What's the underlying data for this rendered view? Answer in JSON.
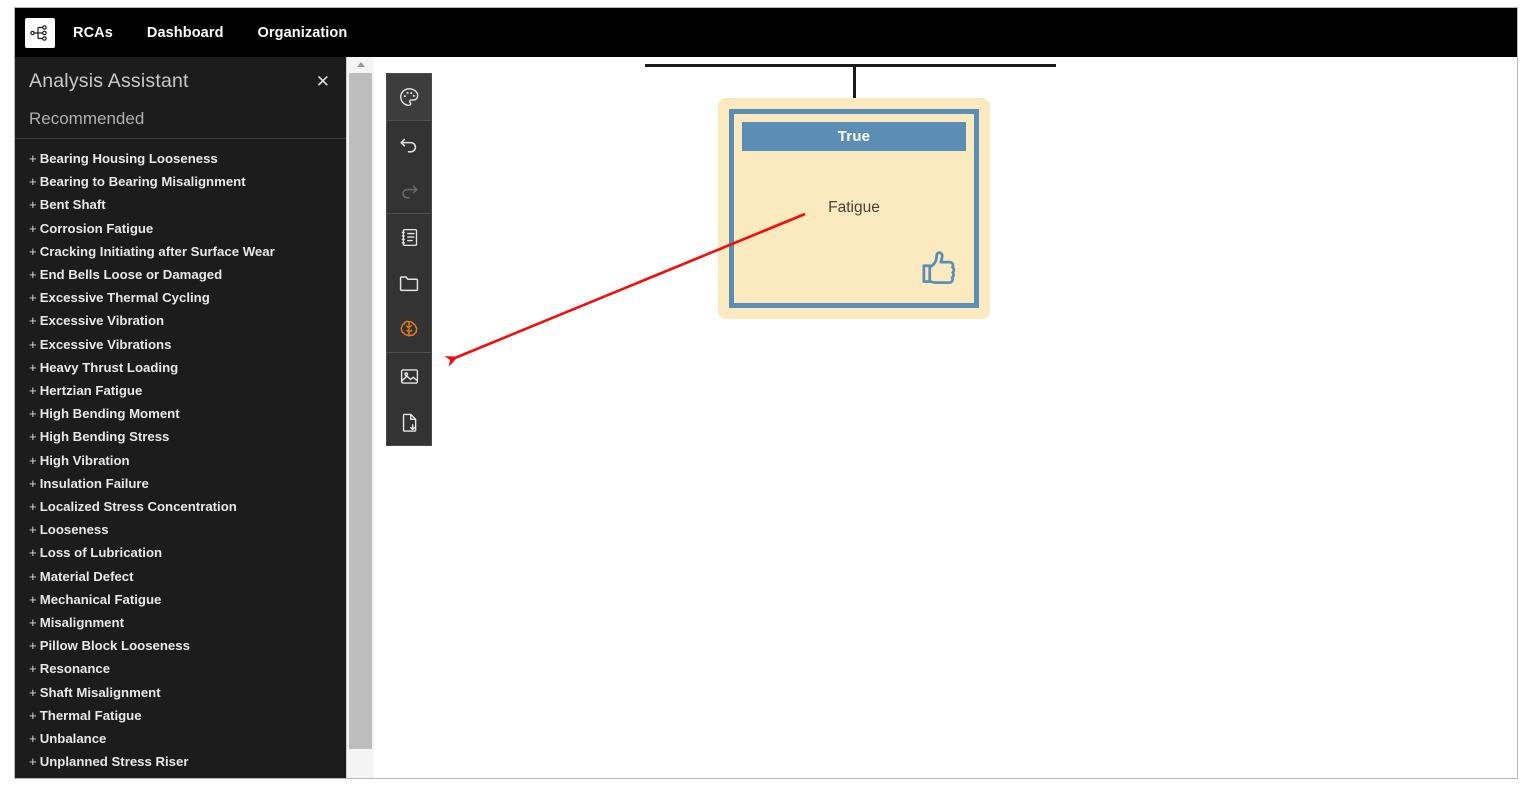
{
  "topnav": {
    "logo_icon": "node-tree-logo-icon",
    "links": [
      {
        "label": "RCAs"
      },
      {
        "label": "Dashboard"
      },
      {
        "label": "Organization"
      }
    ]
  },
  "sidebar": {
    "title": "Analysis Assistant",
    "close_label": "✕",
    "section_label": "Recommended",
    "prefix": "+",
    "items": [
      {
        "label": "Bearing Housing Looseness"
      },
      {
        "label": "Bearing to Bearing Misalignment"
      },
      {
        "label": "Bent Shaft"
      },
      {
        "label": "Corrosion Fatigue"
      },
      {
        "label": "Cracking Initiating after Surface Wear"
      },
      {
        "label": "End Bells Loose or Damaged"
      },
      {
        "label": "Excessive Thermal Cycling"
      },
      {
        "label": "Excessive Vibration"
      },
      {
        "label": "Excessive Vibrations"
      },
      {
        "label": "Heavy Thrust Loading"
      },
      {
        "label": "Hertzian Fatigue"
      },
      {
        "label": "High Bending Moment"
      },
      {
        "label": "High Bending Stress"
      },
      {
        "label": "High Vibration"
      },
      {
        "label": "Insulation Failure"
      },
      {
        "label": "Localized Stress Concentration"
      },
      {
        "label": "Looseness"
      },
      {
        "label": "Loss of Lubrication"
      },
      {
        "label": "Material Defect"
      },
      {
        "label": "Mechanical Fatigue"
      },
      {
        "label": "Misalignment"
      },
      {
        "label": "Pillow Block Looseness"
      },
      {
        "label": "Resonance"
      },
      {
        "label": "Shaft Misalignment"
      },
      {
        "label": "Thermal Fatigue"
      },
      {
        "label": "Unbalance"
      },
      {
        "label": "Unplanned Stress Riser"
      }
    ]
  },
  "toolbar": {
    "tools": [
      {
        "name": "theme-palette-icon",
        "state": "active"
      },
      {
        "name": "undo-icon",
        "state": "enabled"
      },
      {
        "name": "redo-icon",
        "state": "disabled"
      },
      {
        "name": "notes-list-icon",
        "state": "enabled"
      },
      {
        "name": "folder-icon",
        "state": "enabled"
      },
      {
        "name": "brain-icon",
        "state": "selected"
      },
      {
        "name": "image-export-icon",
        "state": "enabled"
      },
      {
        "name": "file-download-icon",
        "state": "enabled"
      }
    ]
  },
  "canvas": {
    "node": {
      "header_label": "True",
      "body_label": "Fatigue",
      "vote_icon": "thumbs-up-icon",
      "header_color": "#5b8db5",
      "body_color": "#fbe9c0",
      "border_color": "#5b8db5"
    },
    "annotation": {
      "arrow_color": "#f60b0b",
      "arrow_from": "790,206",
      "arrow_to": "430,352"
    }
  }
}
